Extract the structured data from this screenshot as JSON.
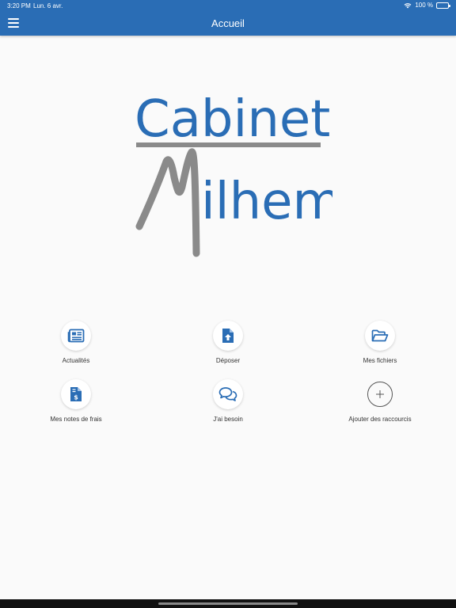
{
  "status_bar": {
    "time": "3:20 PM",
    "date": "Lun. 6 avr.",
    "battery": "100 %"
  },
  "header": {
    "title": "Accueil"
  },
  "logo": {
    "line1": "Cabinet",
    "line2": "ilhem"
  },
  "shortcuts": [
    {
      "label": "Actualités",
      "icon": "newspaper-icon"
    },
    {
      "label": "Déposer",
      "icon": "file-upload-icon"
    },
    {
      "label": "Mes fichiers",
      "icon": "folder-open-icon"
    },
    {
      "label": "Mes notes de frais",
      "icon": "file-invoice-dollar-icon"
    },
    {
      "label": "J'ai besoin",
      "icon": "comments-icon"
    },
    {
      "label": "Ajouter des raccourcis",
      "icon": "plus-icon"
    }
  ],
  "colors": {
    "header": "#2a6db5",
    "icon": "#2a6db5",
    "logo_blue": "#2a6db5",
    "logo_gray": "#8a8a8a"
  }
}
